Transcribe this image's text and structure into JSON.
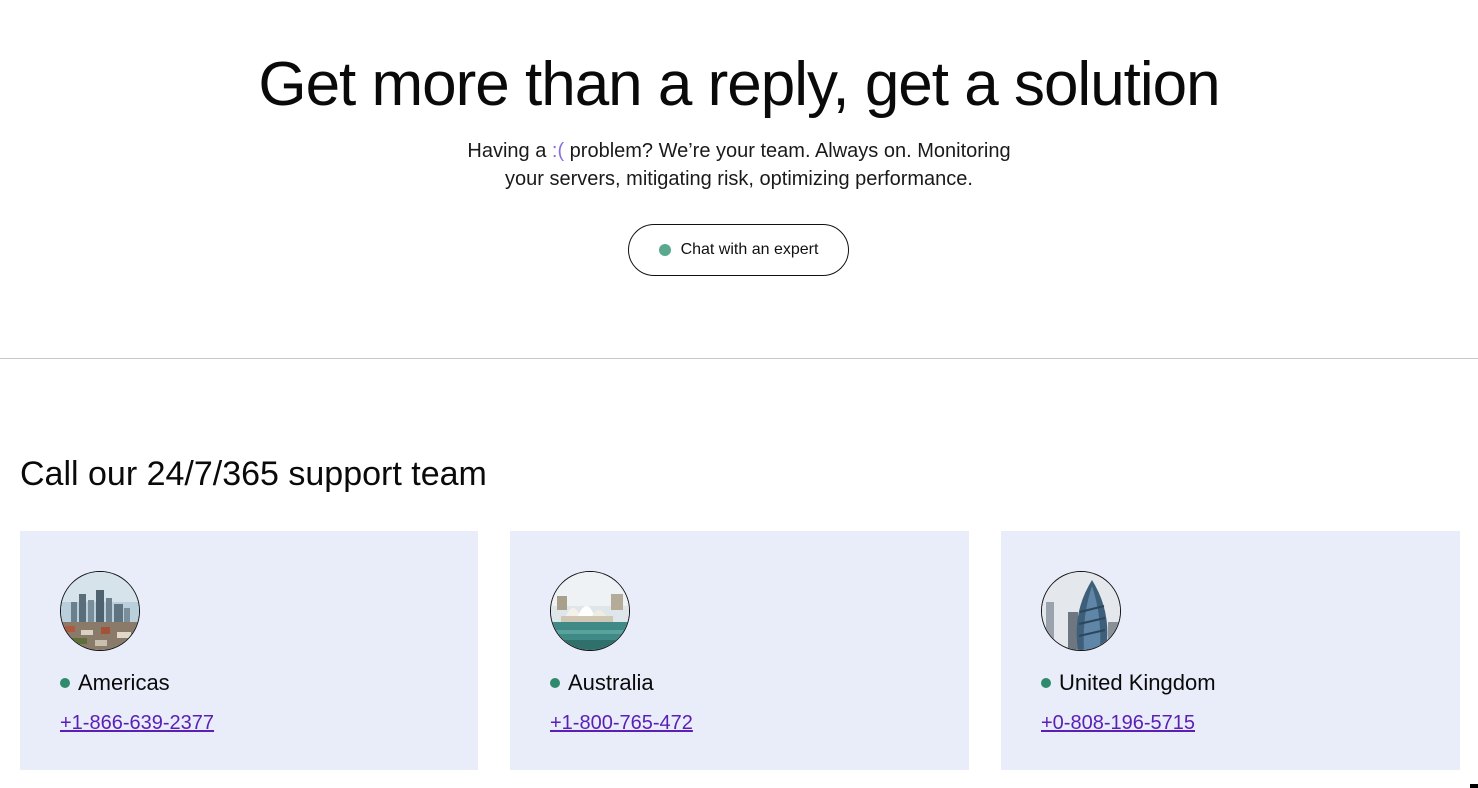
{
  "hero": {
    "title": "Get more than a reply, get a solution",
    "subtitle_line1_pre": "Having a ",
    "subtitle_face": ":(",
    "subtitle_line1_post": " problem? We’re your team. Always on. Monitoring",
    "subtitle_line2": "your servers, mitigating risk, optimizing performance.",
    "chat_button_label": "Chat with an expert"
  },
  "support": {
    "title": "Call our 24/7/365 support team",
    "cards": [
      {
        "region": "Americas",
        "phone": "+1-866-639-2377",
        "image": "city-skyline-icon"
      },
      {
        "region": "Australia",
        "phone": "+1-800-765-472",
        "image": "opera-house-icon"
      },
      {
        "region": "United Kingdom",
        "phone": "+0-808-196-5715",
        "image": "gherkin-tower-icon"
      }
    ]
  },
  "colors": {
    "card_bg": "#e9ecf9",
    "status_dot": "#2e8a6c",
    "chat_dot": "#5aa98f",
    "link": "#5a1fb5",
    "face_accent": "#8a6ee0"
  }
}
